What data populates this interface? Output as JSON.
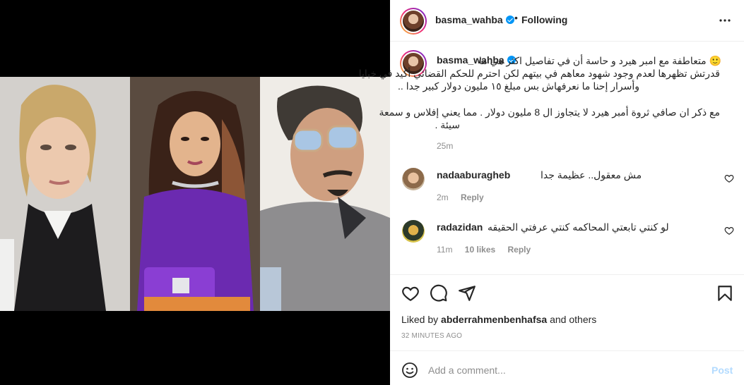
{
  "post": {
    "author": "basma_wahba",
    "follow_state": "Following",
    "dot": "•",
    "caption_lines": [
      "🙂 متعاطفة مع امبر هيرد و حاسة أن في تفاصيل اكثر هي ما",
      "قدرتش تظهرها لعدم وجود شهود معاهم في بيتهم لكن احترم للحكم القضائي أكيد في خبايا",
      "وأسرار إحنا ما نعرفهاش بس مبلغ ١٥ مليون دولار كبير جدا ..",
      "",
      "مع ذكر ان صافي ثروة أمبر هيرد لا يتجاوز ال 8 مليون دولار . مما يعني إفلاس و سمعة",
      "سيئة ."
    ],
    "caption_time": "25m",
    "liked_by_prefix": "Liked by ",
    "liked_by_user": "abderrahmenbenhafsa",
    "liked_by_suffix": " and others",
    "age": "32 MINUTES AGO"
  },
  "comments": [
    {
      "user": "nadaaburagheb",
      "text": "مش معقول.. عظيمة جدا",
      "time": "2m",
      "likes": "",
      "reply": "Reply"
    },
    {
      "user": "radazidan",
      "text": "لو كنتي تابعتي المحاكمه كنتي عرفتي الحقيقه",
      "time": "11m",
      "likes": "10 likes",
      "reply": "Reply"
    }
  ],
  "composer": {
    "placeholder": "Add a comment...",
    "post_label": "Post"
  },
  "icons": {
    "more": "more-horizontal-icon",
    "like": "heart-icon",
    "comment": "comment-bubble-icon",
    "share": "paper-plane-icon",
    "save": "bookmark-icon",
    "emoji": "smiley-icon"
  },
  "colors": {
    "verified": "#0095f6",
    "post_disabled": "#b3dbff",
    "meta_gray": "#8e8e8e"
  }
}
